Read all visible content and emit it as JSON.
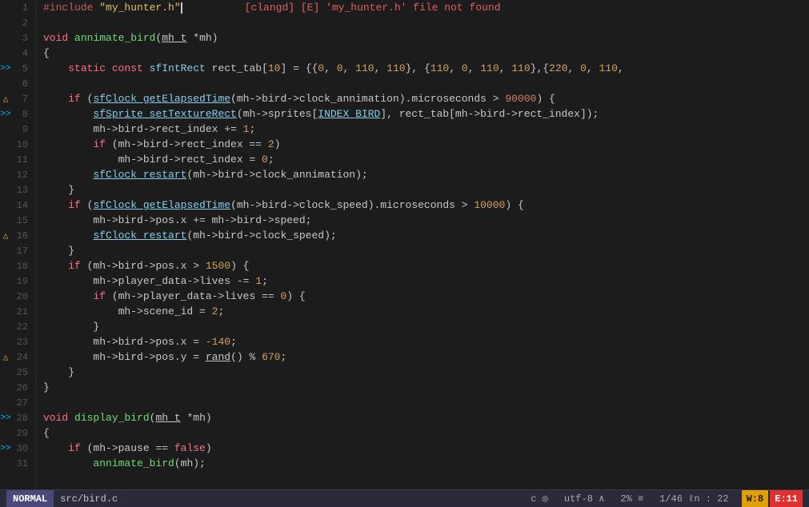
{
  "editor": {
    "mode": "NORMAL",
    "file": "src/bird.c",
    "encoding": "utf-8",
    "percent": "2%",
    "position": "1/46",
    "ln": "22",
    "warnings": "W:8",
    "errors": "E:11"
  },
  "lines": [
    {
      "num": 1,
      "ind": "",
      "content_type": "preproc_line"
    },
    {
      "num": 2,
      "ind": "",
      "content_type": "blank"
    },
    {
      "num": 3,
      "ind": "",
      "content_type": "fn_decl"
    },
    {
      "num": 4,
      "ind": "",
      "content_type": "open_brace"
    },
    {
      "num": 5,
      "ind": ">>",
      "content_type": "static_line"
    },
    {
      "num": 6,
      "ind": "",
      "content_type": "blank"
    },
    {
      "num": 7,
      "ind": "",
      "content_type": "if_clock_anim"
    },
    {
      "num": 8,
      "ind": ">>",
      "content_type": "sfsprite_line"
    },
    {
      "num": 9,
      "ind": "",
      "content_type": "rect_index_inc"
    },
    {
      "num": 10,
      "ind": "",
      "content_type": "if_rect_eq2"
    },
    {
      "num": 11,
      "ind": "",
      "content_type": "rect_index_0"
    },
    {
      "num": 12,
      "ind": "",
      "content_type": "sfclock_restart_anim"
    },
    {
      "num": 13,
      "ind": "",
      "content_type": "close_brace_inner"
    },
    {
      "num": 14,
      "ind": "",
      "content_type": "if_clock_speed"
    },
    {
      "num": 15,
      "ind": "",
      "content_type": "posx_speed"
    },
    {
      "num": 16,
      "ind": "",
      "content_type": "sfclock_restart_speed"
    },
    {
      "num": 17,
      "ind": "",
      "content_type": "close_brace_inner2"
    },
    {
      "num": 18,
      "ind": "",
      "content_type": "if_posx_1500"
    },
    {
      "num": 19,
      "ind": "",
      "content_type": "lives_dec"
    },
    {
      "num": 20,
      "ind": "",
      "content_type": "if_lives_0"
    },
    {
      "num": 21,
      "ind": "",
      "content_type": "scene_id_2"
    },
    {
      "num": 22,
      "ind": "",
      "content_type": "close_brace_lives"
    },
    {
      "num": 23,
      "ind": "",
      "content_type": "posx_neg140"
    },
    {
      "num": 24,
      "ind": "",
      "content_type": "posy_rand"
    },
    {
      "num": 25,
      "ind": "",
      "content_type": "close_brace_if"
    },
    {
      "num": 26,
      "ind": "",
      "content_type": "close_brace_outer"
    },
    {
      "num": 27,
      "ind": "",
      "content_type": "blank"
    },
    {
      "num": 28,
      "ind": ">>",
      "content_type": "void_display"
    },
    {
      "num": 29,
      "ind": "",
      "content_type": "open_brace2"
    },
    {
      "num": 30,
      "ind": ">>",
      "content_type": "if_pause"
    },
    {
      "num": 31,
      "ind": "",
      "content_type": "annimate_call"
    }
  ]
}
